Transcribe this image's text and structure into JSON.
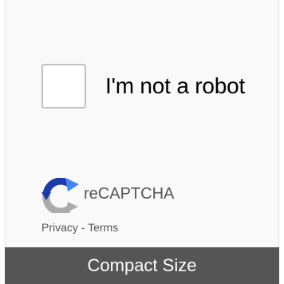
{
  "widget": {
    "checkbox_label": "I'm not a robot",
    "brand": "reCAPTCHA",
    "privacy_link": "Privacy",
    "separator": " - ",
    "terms_link": "Terms",
    "logo_icon": "recaptcha-logo-icon"
  },
  "caption": {
    "text": "Compact Size"
  },
  "colors": {
    "logo_blue": "#1c3aa9",
    "logo_light_blue": "#4285f4",
    "logo_gray": "#ababab",
    "caption_bar": "#555555",
    "widget_bg": "#f9f9f9"
  }
}
